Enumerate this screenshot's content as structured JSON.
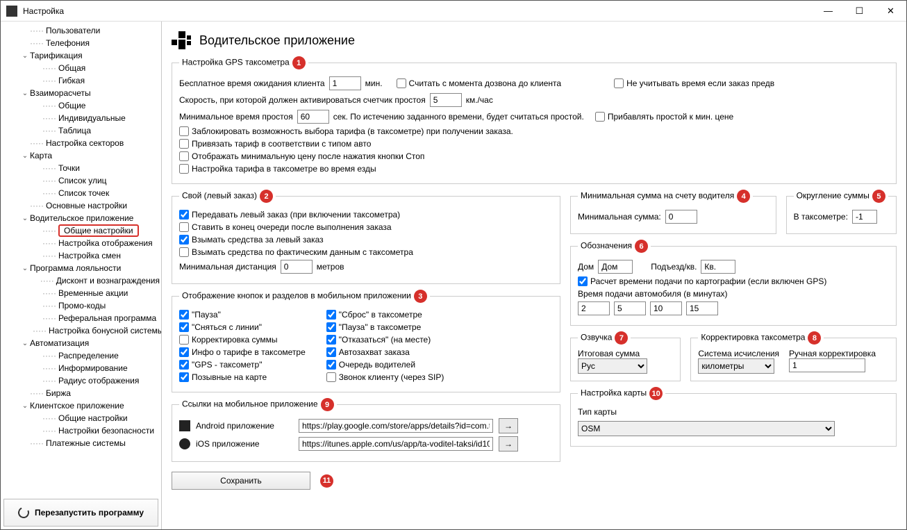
{
  "window": {
    "title": "Настройка"
  },
  "sidebar": {
    "restart": "Перезапустить программу",
    "items": [
      {
        "d": 1,
        "t": "i",
        "label": "Пользователи"
      },
      {
        "d": 1,
        "t": "i",
        "label": "Телефония"
      },
      {
        "d": 1,
        "t": "e",
        "label": "Тарификация"
      },
      {
        "d": 2,
        "t": "i",
        "label": "Общая"
      },
      {
        "d": 2,
        "t": "i",
        "label": "Гибкая"
      },
      {
        "d": 1,
        "t": "e",
        "label": "Взаиморасчеты"
      },
      {
        "d": 2,
        "t": "i",
        "label": "Общие"
      },
      {
        "d": 2,
        "t": "i",
        "label": "Индивидуальные"
      },
      {
        "d": 2,
        "t": "i",
        "label": "Таблица"
      },
      {
        "d": 1,
        "t": "i",
        "label": "Настройка секторов"
      },
      {
        "d": 1,
        "t": "e",
        "label": "Карта"
      },
      {
        "d": 2,
        "t": "i",
        "label": "Точки"
      },
      {
        "d": 2,
        "t": "i",
        "label": "Список улиц"
      },
      {
        "d": 2,
        "t": "i",
        "label": "Список точек"
      },
      {
        "d": 1,
        "t": "i",
        "label": "Основные настройки"
      },
      {
        "d": 1,
        "t": "e",
        "label": "Водительское приложение"
      },
      {
        "d": 2,
        "t": "i",
        "label": "Общие настройки",
        "sel": true
      },
      {
        "d": 2,
        "t": "i",
        "label": "Настройка отображения"
      },
      {
        "d": 2,
        "t": "i",
        "label": "Настройка смен"
      },
      {
        "d": 1,
        "t": "e",
        "label": "Программа лояльности"
      },
      {
        "d": 2,
        "t": "i",
        "label": "Дисконт и вознаграждения"
      },
      {
        "d": 2,
        "t": "i",
        "label": "Временные акции"
      },
      {
        "d": 2,
        "t": "i",
        "label": "Промо-коды"
      },
      {
        "d": 2,
        "t": "i",
        "label": "Реферальная программа"
      },
      {
        "d": 2,
        "t": "i",
        "label": "Настройка бонусной системы"
      },
      {
        "d": 1,
        "t": "e",
        "label": "Автоматизация"
      },
      {
        "d": 2,
        "t": "i",
        "label": "Распределение"
      },
      {
        "d": 2,
        "t": "i",
        "label": "Информирование"
      },
      {
        "d": 2,
        "t": "i",
        "label": "Радиус отображения"
      },
      {
        "d": 1,
        "t": "i",
        "label": "Биржа"
      },
      {
        "d": 1,
        "t": "e",
        "label": "Клиентское приложение"
      },
      {
        "d": 2,
        "t": "i",
        "label": "Общие настройки"
      },
      {
        "d": 2,
        "t": "i",
        "label": "Настройки безопасности"
      },
      {
        "d": 1,
        "t": "i",
        "label": "Платежные системы"
      }
    ]
  },
  "page": {
    "title": "Водительское приложение"
  },
  "gps": {
    "legend": "Настройка GPS таксометра",
    "free_wait_label": "Бесплатное время ожидания клиента",
    "free_wait_value": "1",
    "free_wait_unit": "мин.",
    "count_from_call": "Считать с момента дозвона до клиента",
    "ignore_time_if_prepaid": "Не учитывать время если заказ предв",
    "speed_label": "Скорость, при которой  должен активироваться счетчик простоя",
    "speed_value": "5",
    "speed_unit": "км./час",
    "min_idle_label": "Минимальное время простоя",
    "min_idle_value": "60",
    "min_idle_unit": "сек.  По истечению заданного времени, будет считаться простой.",
    "add_idle_to_min": "Прибавлять простой к мин. цене",
    "lock_tariff": "Заблокировать возможность выбора тарифа (в таксометре) при получении заказа.",
    "bind_tariff_auto": "Привязать тариф в соответствии с типом авто",
    "show_min_price": "Отображать минимальную цену после нажатия кнопки Стоп",
    "tariff_while_moving": "Настройка тарифа в таксометре во время езды"
  },
  "left_order": {
    "legend": "Свой (левый заказ)",
    "transmit": "Передавать левый заказ (при включении таксометра)",
    "queue_end": "Ставить в конец очереди после выполнения заказа",
    "charge": "Взымать средства за левый заказ",
    "charge_actual": "Взымать средства по фактическим данным с таксометра",
    "min_dist_label": "Минимальная дистанция",
    "min_dist_value": "0",
    "min_dist_unit": "метров"
  },
  "buttons": {
    "legend": "Отображение кнопок и разделов в мобильном приложении",
    "pause": "\"Пауза\"",
    "offline": "\"Сняться с линии\"",
    "sum_corr": "Корректировка суммы",
    "tariff_info": "Инфо о тарифе в таксометре",
    "gps_tax": "\"GPS - таксометр\"",
    "callsigns": "Позывные на карте",
    "reset_tax": "\"Сброс\" в таксометре",
    "pause_tax": "\"Пауза\" в таксометре",
    "decline": "\"Отказаться\" (на месте)",
    "auto_grab": "Автозахват заказа",
    "driver_queue": "Очередь водителей",
    "sip_call": "Звонок клиенту (через SIP)"
  },
  "links": {
    "legend": "Ссылки на мобильное приложение",
    "android_label": "Android приложение",
    "android_url": "https://play.google.com/store/apps/details?id=com.ta",
    "ios_label": "iOS приложение",
    "ios_url": "https://itunes.apple.com/us/app/ta-voditel-taksi/id10"
  },
  "min_sum": {
    "legend": "Минимальная сумма на счету водителя",
    "label": "Минимальная сумма:",
    "value": "0"
  },
  "rounding": {
    "legend": "Округление суммы",
    "label": "В таксометре:",
    "value": "-1"
  },
  "marks": {
    "legend": "Обозначения",
    "house_label": "Дом",
    "house_value": "Дом",
    "entrance_label": "Подъезд/кв.",
    "entrance_value": "Кв.",
    "calc_by_map": "Расчет времени подачи по картографии (если включен GPS)",
    "arrival_label": "Время подачи автомобиля (в минутах)",
    "t1": "2",
    "t2": "5",
    "t3": "10",
    "t4": "15"
  },
  "voice": {
    "legend": "Озвучка",
    "total_label": "Итоговая сумма",
    "total_value": "Рус"
  },
  "tax_corr": {
    "legend": "Корректировка таксометра",
    "system_label": "Система исчисления",
    "system_value": "километры",
    "manual_label": "Ручная корректировка",
    "manual_value": "1"
  },
  "map": {
    "legend": "Настройка карты",
    "type_label": "Тип карты",
    "type_value": "OSM"
  },
  "save": "Сохранить",
  "go_arrow": "→"
}
